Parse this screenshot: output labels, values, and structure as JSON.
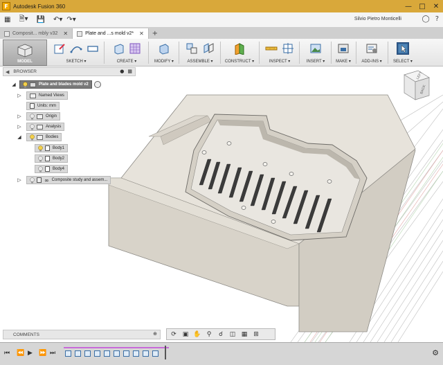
{
  "window": {
    "title": "Autodesk Fusion 360",
    "logo_letter": "F"
  },
  "quick_access": {
    "user_name": "Silvio Pietro Monticelli"
  },
  "tabs": [
    {
      "label": "Composit... mbly v32",
      "active": false
    },
    {
      "label": "Plate and ...s mold v2*",
      "active": true
    }
  ],
  "ribbon": {
    "workspace": "MODEL",
    "groups": [
      {
        "label": "SKETCH"
      },
      {
        "label": "CREATE"
      },
      {
        "label": "MODIFY"
      },
      {
        "label": "ASSEMBLE"
      },
      {
        "label": "CONSTRUCT"
      },
      {
        "label": "INSPECT"
      },
      {
        "label": "INSERT"
      },
      {
        "label": "MAKE"
      },
      {
        "label": "ADD-INS"
      },
      {
        "label": "SELECT"
      }
    ]
  },
  "browser": {
    "title": "BROWSER",
    "root": "Plate and blades mold v2",
    "items": [
      {
        "label": "Named Views"
      },
      {
        "label": "Units: mm"
      },
      {
        "label": "Origin"
      },
      {
        "label": "Analysis"
      },
      {
        "label": "Bodies"
      },
      {
        "label": "Body1"
      },
      {
        "label": "Body2"
      },
      {
        "label": "Body4"
      },
      {
        "label": "Composite study and assem..."
      }
    ]
  },
  "viewcube": {
    "top_face": "LEFT",
    "side_face": "BACK"
  },
  "comments": {
    "label": "COMMENTS"
  },
  "colors": {
    "titlebar": "#d9a83a",
    "selection_blue": "#3a6ea5",
    "mold_face": "#e5e1d9",
    "mold_side": "#d2cdc3"
  }
}
